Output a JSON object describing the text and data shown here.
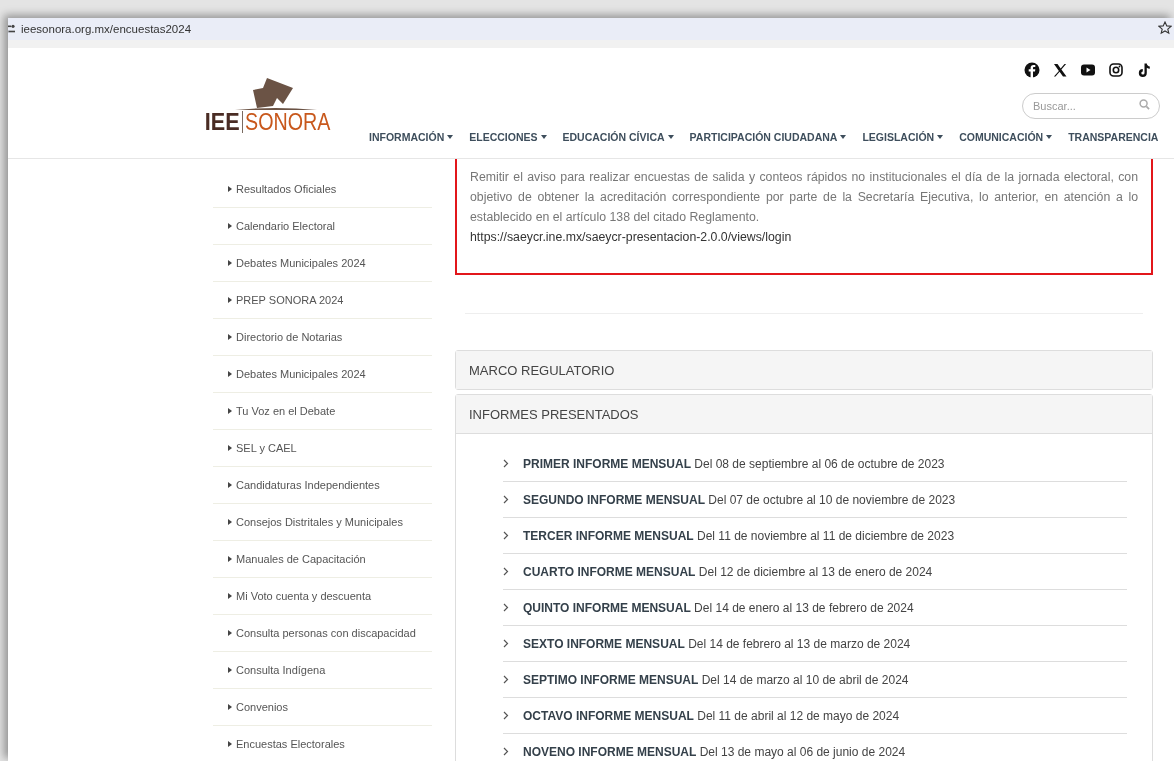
{
  "browser": {
    "url": "ieesonora.org.mx/encuestas2024"
  },
  "logo": {
    "part_1": "IEE",
    "part_2": "SONORA"
  },
  "nav": [
    {
      "label": "INFORMACIÓN",
      "dropdown": true
    },
    {
      "label": "ELECCIONES",
      "dropdown": true
    },
    {
      "label": "EDUCACIÓN CÍVICA",
      "dropdown": true
    },
    {
      "label": "PARTICIPACIÓN CIUDADANA",
      "dropdown": true
    },
    {
      "label": "LEGISLACIÓN",
      "dropdown": true
    },
    {
      "label": "COMUNICACIÓN",
      "dropdown": true
    },
    {
      "label": "TRANSPARENCIA",
      "dropdown": false
    }
  ],
  "search": {
    "placeholder": "Buscar..."
  },
  "sidebar": {
    "items": [
      "Resultados Oficiales",
      "Calendario Electoral",
      "Debates Municipales 2024",
      "PREP SONORA 2024",
      "Directorio de Notarias",
      "Debates Municipales 2024",
      "Tu Voz en el Debate",
      "SEL y CAEL",
      "Candidaturas Independientes",
      "Consejos Distritales y Municipales",
      "Manuales de Capacitación",
      "Mi Voto cuenta y descuenta",
      "Consulta personas con discapacidad",
      "Consulta Indígena",
      "Convenios",
      "Encuestas Electorales"
    ]
  },
  "notice": {
    "text": "Remitir el aviso para realizar encuestas de salida y conteos rápidos no institucionales el día de la jornada electoral, con objetivo de obtener la acreditación correspondiente por parte de la Secretaría Ejecutiva, lo anterior, en atención a lo establecido en el artículo 138 del citado Reglamento.",
    "link": "https://saeycr.ine.mx/saeycr-presentacion-2.0.0/views/login"
  },
  "accordion": [
    {
      "title": "MARCO REGULATORIO",
      "expanded": false
    },
    {
      "title": "INFORMES PRESENTADOS",
      "expanded": true,
      "reports": [
        "**PRIMER INFORME MENSUAL** Del 08 de septiembre al 06 de octubre de 2023",
        "**SEGUNDO INFORME MENSUAL** Del 07 de octubre al 10 de noviembre de 2023",
        "**TERCER INFORME MENSUAL** Del 11 de noviembre al 11 de diciembre de 2023",
        "**CUARTO INFORME MENSUAL** Del 12 de diciembre al 13 de enero de 2024",
        "**QUINTO INFORME MENSUAL** Del 14 de enero al 13 de febrero de 2024",
        "**SEXTO INFORME MENSUAL** Del 14 de febrero al 13 de marzo de 2024",
        "**SEPTIMO INFORME MENSUAL** Del 14 de marzo al 10 de abril de 2024",
        "**OCTAVO INFORME MENSUAL** Del 11 de abril al 12 de mayo de 2024",
        "**NOVENO INFORME MENSUAL** Del 13 de mayo al 06 de junio de 2024"
      ]
    }
  ]
}
